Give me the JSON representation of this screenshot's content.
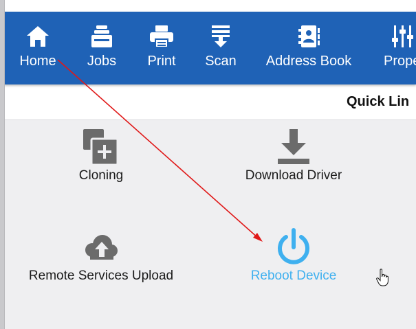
{
  "nav": {
    "items": [
      {
        "label": "Home",
        "icon": "home-icon"
      },
      {
        "label": "Jobs",
        "icon": "jobs-icon"
      },
      {
        "label": "Print",
        "icon": "printer-icon"
      },
      {
        "label": "Scan",
        "icon": "scan-icon"
      },
      {
        "label": "Address Book",
        "icon": "address-book-icon"
      },
      {
        "label": "Prope",
        "icon": "properties-icon"
      }
    ]
  },
  "header": {
    "title": "Quick Lin"
  },
  "tiles": [
    {
      "label": "Cloning",
      "icon": "cloning-icon"
    },
    {
      "label": "Download Driver",
      "icon": "download-icon"
    },
    {
      "label": "Remote Services Upload",
      "icon": "cloud-upload-icon"
    },
    {
      "label": "Reboot Device",
      "icon": "power-icon"
    }
  ],
  "colors": {
    "nav_background": "#1f62b6",
    "accent": "#3fb0ef",
    "icon_gray": "#6b6b6b",
    "annotation_arrow": "#e01818"
  }
}
